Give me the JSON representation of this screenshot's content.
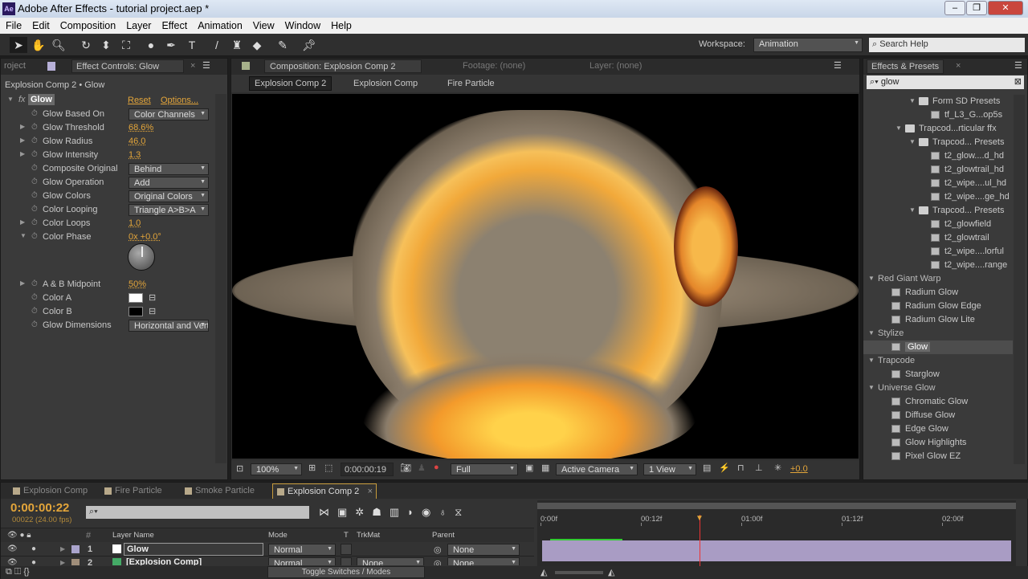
{
  "window": {
    "title": "Adobe After Effects - tutorial project.aep *",
    "logo": "Ae"
  },
  "menu": [
    "File",
    "Edit",
    "Composition",
    "Layer",
    "Effect",
    "Animation",
    "View",
    "Window",
    "Help"
  ],
  "workspace": {
    "label": "Workspace:",
    "value": "Animation",
    "search_placeholder": "Search Help"
  },
  "left": {
    "project_tab": "roject",
    "effect_tab": "Effect Controls: Glow",
    "breadcrumb": "Explosion Comp 2 • Glow",
    "effect_name": "Glow",
    "reset": "Reset",
    "options": "Options...",
    "props": [
      {
        "name": "Glow Based On",
        "dropdown": "Color Channels",
        "tw": false
      },
      {
        "name": "Glow Threshold",
        "value": "68.6%",
        "tw": true
      },
      {
        "name": "Glow Radius",
        "value": "46.0",
        "tw": true
      },
      {
        "name": "Glow Intensity",
        "value": "1.3",
        "tw": true
      },
      {
        "name": "Composite Original",
        "dropdown": "Behind",
        "tw": false
      },
      {
        "name": "Glow Operation",
        "dropdown": "Add",
        "tw": false
      },
      {
        "name": "Glow Colors",
        "dropdown": "Original Colors",
        "tw": false
      },
      {
        "name": "Color Looping",
        "dropdown": "Triangle A>B>A",
        "tw": false
      },
      {
        "name": "Color Loops",
        "value": "1.0",
        "tw": true
      },
      {
        "name": "Color Phase",
        "value": "0x +0.0°",
        "tw": true,
        "open": true
      }
    ],
    "props2": [
      {
        "name": "A & B Midpoint",
        "value": "50%",
        "tw": true
      },
      {
        "name": "Color A",
        "swatch": "#ffffff"
      },
      {
        "name": "Color B",
        "swatch": "#000000"
      },
      {
        "name": "Glow Dimensions",
        "dropdown": "Horizontal and Vertical"
      }
    ]
  },
  "comp": {
    "tab": "Composition: Explosion Comp 2",
    "footage": "Footage: (none)",
    "layer": "Layer: (none)",
    "crumbs": [
      "Explosion Comp 2",
      "Explosion Comp",
      "Fire Particle"
    ],
    "zoom": "100%",
    "time": "0:00:00:19",
    "resolution": "Full",
    "camera": "Active Camera",
    "views": "1 View",
    "exposure": "+0.0"
  },
  "presets": {
    "tab": "Effects & Presets",
    "search": "glow",
    "items": [
      {
        "t": "folder",
        "l": "Form SD Presets",
        "d": 3
      },
      {
        "t": "file",
        "l": "tf_L3_G...op5s",
        "d": 4
      },
      {
        "t": "folder",
        "l": "Trapcod...rticular ffx",
        "d": 2
      },
      {
        "t": "folder",
        "l": "Trapcod... Presets",
        "d": 3
      },
      {
        "t": "file",
        "l": "t2_glow....d_hd",
        "d": 4
      },
      {
        "t": "file",
        "l": "t2_glowtrail_hd",
        "d": 4
      },
      {
        "t": "file",
        "l": "t2_wipe....ul_hd",
        "d": 4
      },
      {
        "t": "file",
        "l": "t2_wipe....ge_hd",
        "d": 4
      },
      {
        "t": "folder",
        "l": "Trapcod... Presets",
        "d": 3
      },
      {
        "t": "file",
        "l": "t2_glowfield",
        "d": 4
      },
      {
        "t": "file",
        "l": "t2_glowtrail",
        "d": 4
      },
      {
        "t": "file",
        "l": "t2_wipe....lorful",
        "d": 4
      },
      {
        "t": "file",
        "l": "t2_wipe....range",
        "d": 4
      },
      {
        "t": "cat",
        "l": "Red Giant Warp",
        "d": 0
      },
      {
        "t": "fx",
        "l": "Radium Glow",
        "d": 1
      },
      {
        "t": "fx",
        "l": "Radium Glow Edge",
        "d": 1
      },
      {
        "t": "fx",
        "l": "Radium Glow Lite",
        "d": 1
      },
      {
        "t": "cat",
        "l": "Stylize",
        "d": 0
      },
      {
        "t": "fx",
        "l": "Glow",
        "d": 1,
        "sel": true
      },
      {
        "t": "cat",
        "l": "Trapcode",
        "d": 0
      },
      {
        "t": "fx",
        "l": "Starglow",
        "d": 1
      },
      {
        "t": "cat",
        "l": "Universe Glow",
        "d": 0
      },
      {
        "t": "fx",
        "l": "Chromatic Glow",
        "d": 1
      },
      {
        "t": "fx",
        "l": "Diffuse Glow",
        "d": 1
      },
      {
        "t": "fx",
        "l": "Edge Glow",
        "d": 1
      },
      {
        "t": "fx",
        "l": "Glow Highlights",
        "d": 1
      },
      {
        "t": "fx",
        "l": "Pixel Glow EZ",
        "d": 1
      }
    ]
  },
  "timeline": {
    "tabs": [
      "Explosion Comp",
      "Fire Particle",
      "Smoke Particle",
      "Explosion Comp 2"
    ],
    "time": "0:00:00:22",
    "frames": "00022 (24.00 fps)",
    "cols": {
      "name": "Layer Name",
      "mode": "Mode",
      "t": "T",
      "trkmat": "TrkMat",
      "parent": "Parent"
    },
    "ruler": [
      "0:00f",
      "00:12f",
      "01:00f",
      "01:12f",
      "02:00f"
    ],
    "layers": [
      {
        "num": "1",
        "name": "Glow",
        "mode": "Normal",
        "trkmat": "",
        "parent": "None"
      },
      {
        "num": "2",
        "name": "[Explosion Comp]",
        "mode": "Normal",
        "trkmat": "None",
        "parent": "None"
      }
    ],
    "toggle": "Toggle Switches / Modes"
  }
}
